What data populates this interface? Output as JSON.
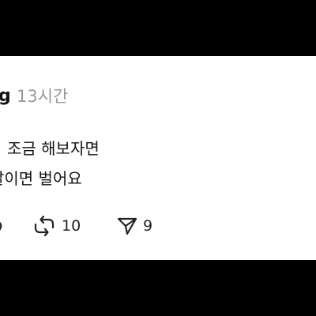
{
  "post": {
    "username": "g",
    "timestamp": "13시간",
    "lines": [
      "조금 해보자면",
      "달이면 벌어요"
    ]
  },
  "actions": {
    "repost_icon": "repost-icon",
    "repost_count": "10",
    "share_icon": "send-icon",
    "share_count": "9"
  },
  "colors": {
    "background": "#000000",
    "card": "#ffffff",
    "text": "#141414",
    "muted": "#9a9a9a"
  }
}
